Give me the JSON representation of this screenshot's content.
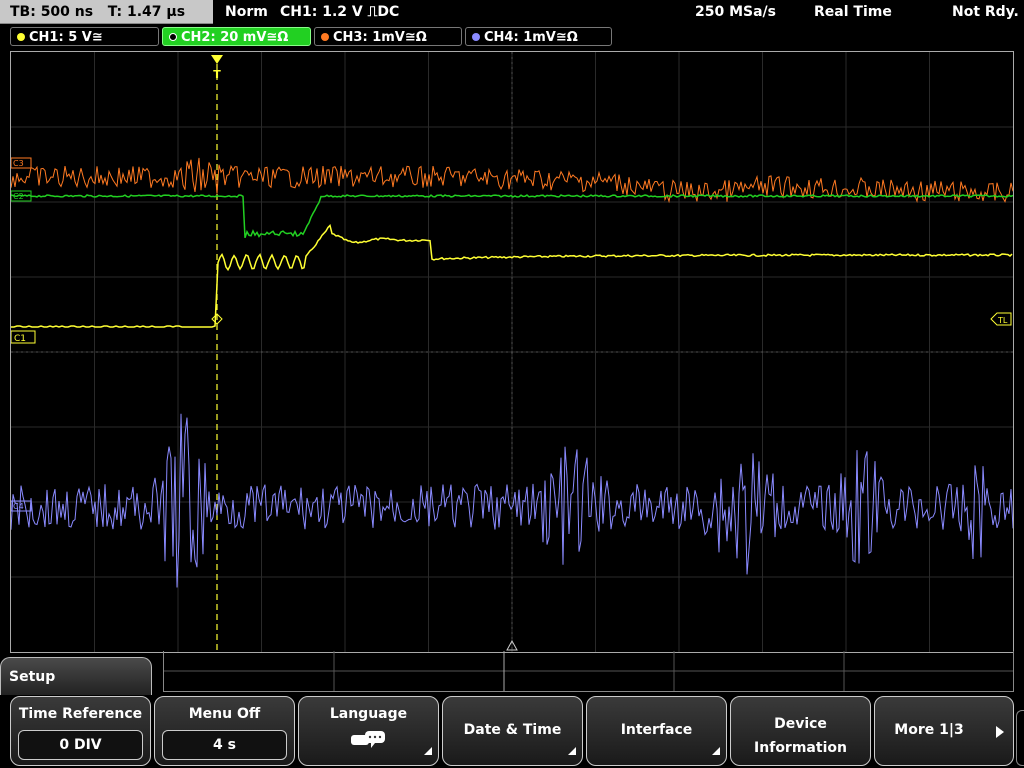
{
  "header": {
    "timebase": "TB: 500 ns",
    "trigger_time": "T: 1.47 µs",
    "mode": "Norm",
    "trigger_info": "CH1: 1.2 V ⎍DC",
    "sample_rate": "250 MSa/s",
    "acq_mode": "Real Time",
    "status": "Not Rdy."
  },
  "channels": [
    {
      "label": "CH1: 5 V≅",
      "color": "#ffff33"
    },
    {
      "label": "CH2: 20 mV≅Ω",
      "color": "#22d022"
    },
    {
      "label": "CH3: 1mV≅Ω",
      "color": "#ff7a22"
    },
    {
      "label": "CH4: 1mV≅Ω",
      "color": "#8a8aff"
    }
  ],
  "screen_markers": {
    "ch1": "C1",
    "ch2": "C2",
    "ch3": "C3",
    "ch4": "C4",
    "trigger_level": "TL",
    "trigger_pos": "T"
  },
  "menu": {
    "title": "Setup",
    "softkeys": [
      {
        "label": "Time Reference",
        "value": "0 DIV"
      },
      {
        "label": "Menu Off",
        "value": "4 s"
      },
      {
        "label": "Language",
        "icon": "speech-bubble-icon"
      },
      {
        "label": "Date & Time"
      },
      {
        "label": "Interface"
      },
      {
        "label": "Device Information",
        "line1": "Device",
        "line2": "Information"
      },
      {
        "label": "More 1|3"
      }
    ]
  }
}
